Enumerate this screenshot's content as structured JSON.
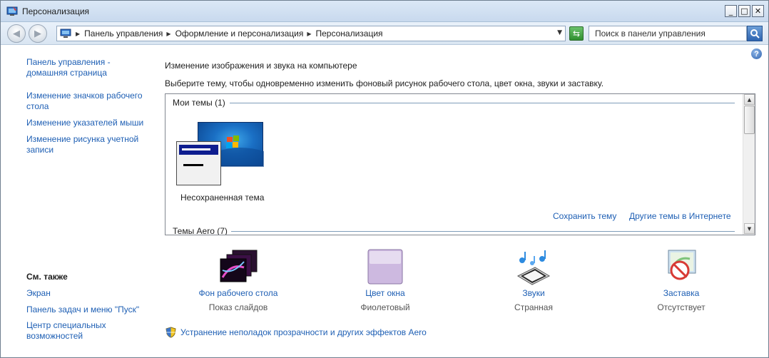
{
  "window": {
    "title": "Персонализация",
    "controls": [
      "_",
      "□",
      "✕"
    ]
  },
  "address": {
    "crumbs": [
      "Панель управления",
      "Оформление и персонализация",
      "Персонализация"
    ],
    "search_placeholder": "Поиск в панели управления"
  },
  "left_nav": {
    "links": [
      "Панель управления - домашняя страница",
      "Изменение значков рабочего стола",
      "Изменение указателей мыши",
      "Изменение рисунка учетной записи"
    ],
    "see_also_title": "См. также",
    "see_also": [
      "Экран",
      "Панель задач и меню \"Пуск\"",
      "Центр специальных возможностей"
    ]
  },
  "main": {
    "heading": "Изменение изображения и звука на компьютере",
    "description": "Выберите тему, чтобы одновременно изменить фоновый рисунок рабочего стола, цвет окна, звуки и заставку.",
    "my_themes_header": "Мои темы (1)",
    "unsaved_theme": "Несохраненная тема",
    "save_theme": "Сохранить тему",
    "more_themes": "Другие темы в Интернете",
    "aero_header": "Темы Aero (7)"
  },
  "tiles": [
    {
      "title": "Фон рабочего стола",
      "value": "Показ слайдов",
      "icon": "desktop-background-icon"
    },
    {
      "title": "Цвет окна",
      "value": "Фиолетовый",
      "icon": "window-color-icon"
    },
    {
      "title": "Звуки",
      "value": "Странная",
      "icon": "sounds-icon"
    },
    {
      "title": "Заставка",
      "value": "Отсутствует",
      "icon": "screensaver-icon"
    }
  ],
  "aero_troubleshoot": "Устранение неполадок прозрачности и других эффектов Aero",
  "colors": {
    "link": "#1e5fb4",
    "window_color": "#c8b6dc"
  }
}
